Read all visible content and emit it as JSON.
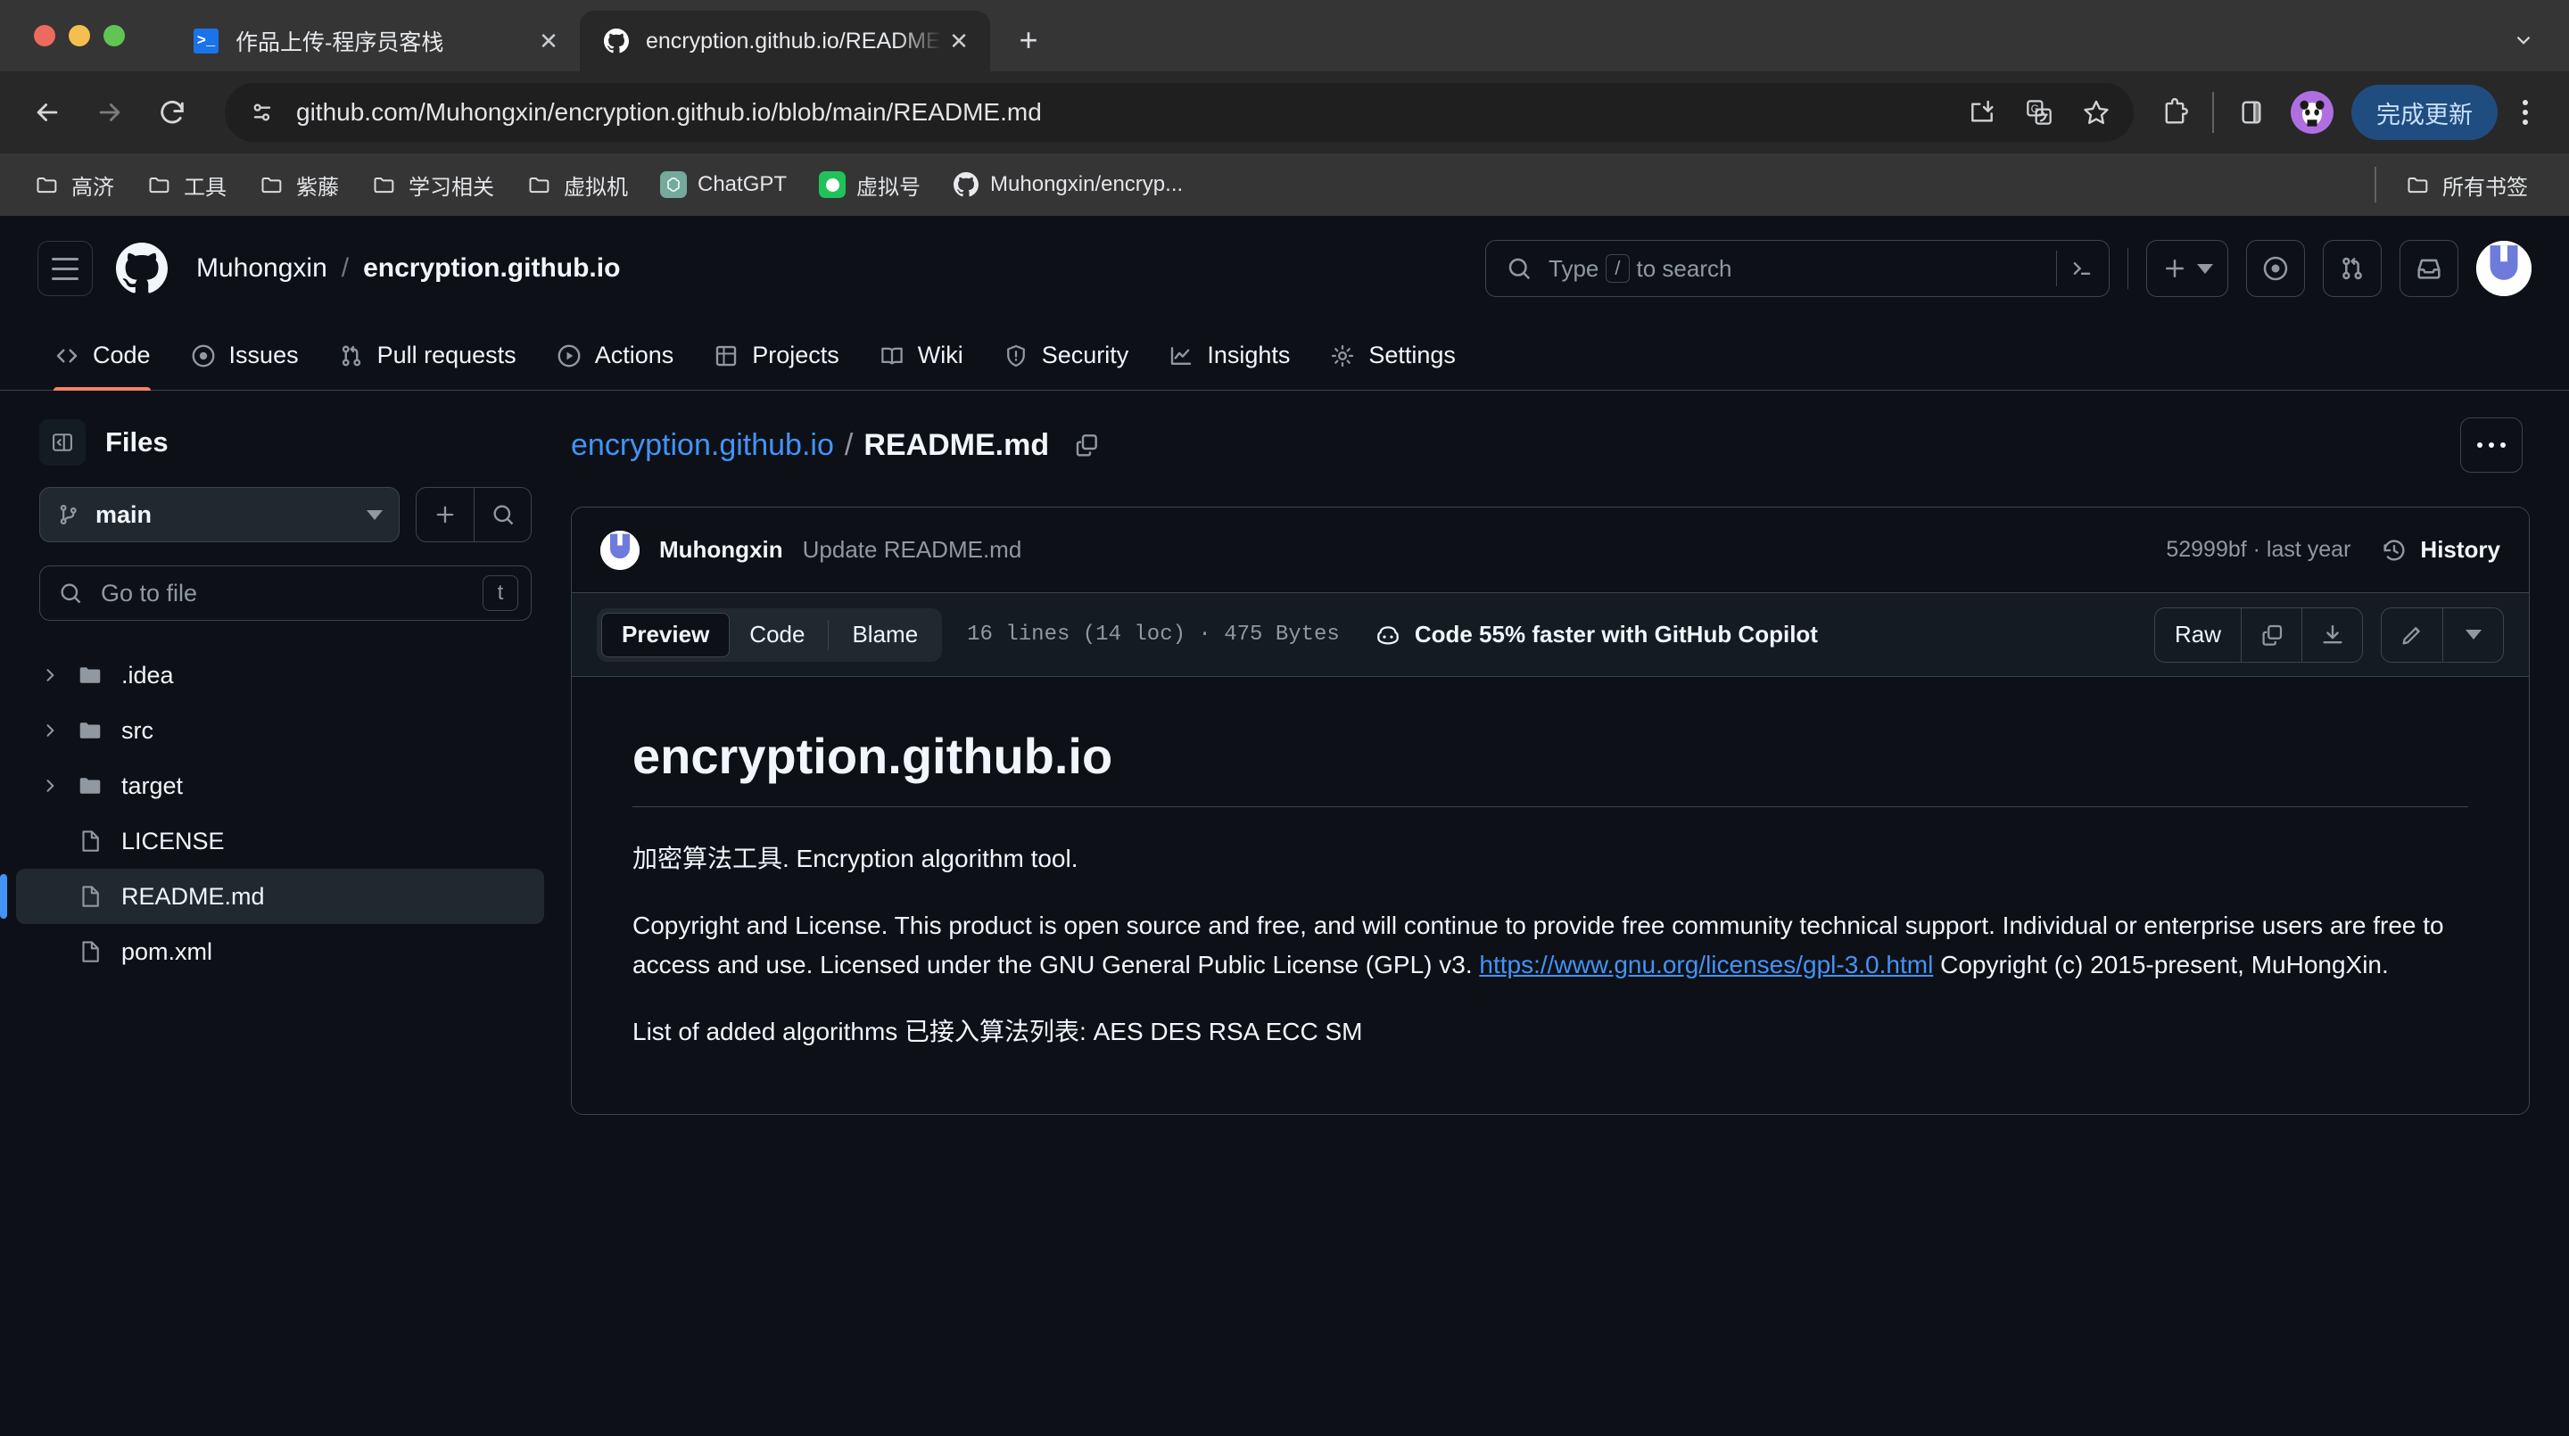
{
  "browser": {
    "tabs": [
      {
        "title": "作品上传-程序员客栈",
        "favicon": "terminal-icon",
        "active": false,
        "close_label": "✕"
      },
      {
        "title": "encryption.github.io/README.md",
        "favicon": "github-icon",
        "active": true,
        "close_label": "✕"
      }
    ],
    "new_tab_label": "+",
    "nav": {
      "back": "←",
      "forward": "→",
      "reload": "⟳"
    },
    "omnibox": {
      "url": "github.com/Muhongxin/encryption.github.io/blob/main/README.md",
      "site_info_icon": "tune-icon",
      "icons": [
        "install-app-icon",
        "translate-icon",
        "bookmark-star-icon"
      ]
    },
    "toolbar_icons": [
      "extensions-puzzle-icon",
      "side-panel-icon"
    ],
    "profile": {
      "icon": "panda-avatar",
      "color": "#b06fe0"
    },
    "update_button": "完成更新",
    "menu_label": "chrome-menu-icon",
    "bookmarks": [
      {
        "label": "高济",
        "icon": "folder-icon"
      },
      {
        "label": "工具",
        "icon": "folder-icon"
      },
      {
        "label": "紫藤",
        "icon": "folder-icon"
      },
      {
        "label": "学习相关",
        "icon": "folder-icon"
      },
      {
        "label": "虚拟机",
        "icon": "folder-icon"
      },
      {
        "label": "ChatGPT",
        "icon": "chatgpt-icon"
      },
      {
        "label": "虚拟号",
        "icon": "green-dot-icon"
      },
      {
        "label": "Muhongxin/encryp...",
        "icon": "github-icon"
      }
    ],
    "all_bookmarks": "所有书签"
  },
  "github": {
    "header": {
      "menu_icon": "hamburger-icon",
      "logo_icon": "github-mark-icon",
      "owner": "Muhongxin",
      "separator": "/",
      "repo": "encryption.github.io",
      "search_placeholder": "Type",
      "search_key": "/",
      "search_suffix": "to search",
      "command_icon": "terminal-prompt-icon",
      "create_icon": "plus-icon",
      "issues_icon": "issue-opened-icon",
      "pulls_icon": "git-pull-request-icon",
      "inbox_icon": "inbox-icon",
      "avatar": "user-avatar"
    },
    "repo_nav": [
      {
        "label": "Code",
        "icon": "code-icon",
        "active": true
      },
      {
        "label": "Issues",
        "icon": "issue-opened-icon",
        "active": false
      },
      {
        "label": "Pull requests",
        "icon": "git-pull-request-icon",
        "active": false
      },
      {
        "label": "Actions",
        "icon": "play-circle-icon",
        "active": false
      },
      {
        "label": "Projects",
        "icon": "table-icon",
        "active": false
      },
      {
        "label": "Wiki",
        "icon": "book-icon",
        "active": false
      },
      {
        "label": "Security",
        "icon": "shield-icon",
        "active": false
      },
      {
        "label": "Insights",
        "icon": "graph-icon",
        "active": false
      },
      {
        "label": "Settings",
        "icon": "gear-icon",
        "active": false
      }
    ],
    "sidebar": {
      "title": "Files",
      "collapse_icon": "sidebar-collapse-icon",
      "branch": "main",
      "branch_icon": "git-branch-icon",
      "add_icon": "plus-icon",
      "search_icon": "search-icon",
      "file_search_placeholder": "Go to file",
      "file_search_key": "t",
      "tree": [
        {
          "name": ".idea",
          "type": "folder"
        },
        {
          "name": "src",
          "type": "folder"
        },
        {
          "name": "target",
          "type": "folder"
        },
        {
          "name": "LICENSE",
          "type": "file"
        },
        {
          "name": "README.md",
          "type": "file",
          "selected": true
        },
        {
          "name": "pom.xml",
          "type": "file"
        }
      ]
    },
    "breadcrumb": {
      "repo": "encryption.github.io",
      "separator": "/",
      "file": "README.md",
      "copy_icon": "copy-icon",
      "more_icon": "kebab-horizontal-icon"
    },
    "commit": {
      "author": "Muhongxin",
      "message": "Update README.md",
      "sha_time": "52999bf · last year",
      "history_label": "History",
      "history_icon": "history-clock-icon"
    },
    "view_toolbar": {
      "tabs": [
        {
          "label": "Preview",
          "active": true
        },
        {
          "label": "Code",
          "active": false
        },
        {
          "label": "Blame",
          "active": false
        }
      ],
      "meta": "16 lines (14 loc) · 475 Bytes",
      "copilot_icon": "copilot-icon",
      "copilot_text": "Code 55% faster with GitHub Copilot",
      "raw_label": "Raw",
      "copy_icon": "copy-icon",
      "download_icon": "download-icon",
      "edit_icon": "pencil-icon",
      "edit_caret": "chevron-down-icon"
    },
    "readme": {
      "heading": "encryption.github.io",
      "paragraph1": "加密算法工具. Encryption algorithm tool.",
      "paragraph2_before": "Copyright and License. This product is open source and free, and will continue to provide free community technical support. Individual or enterprise users are free to access and use. Licensed under the GNU General Public License (GPL) v3. ",
      "paragraph2_link": "https://www.gnu.org/licenses/gpl-3.0.html",
      "paragraph2_after": " Copyright (c) 2015-present, MuHongXin.",
      "paragraph3": "List of added algorithms 已接入算法列表: AES DES RSA ECC SM"
    }
  }
}
